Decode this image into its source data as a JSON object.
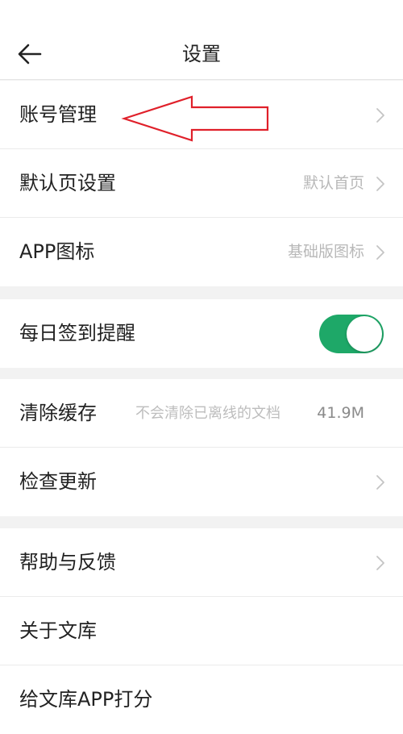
{
  "header": {
    "title": "设置",
    "back_icon": "arrow-left-icon"
  },
  "groups": [
    {
      "rows": [
        {
          "label": "账号管理",
          "value": "",
          "chevron": true
        },
        {
          "label": "默认页设置",
          "value": "默认首页",
          "chevron": true
        },
        {
          "label": "APP图标",
          "value": "基础版图标",
          "chevron": true
        }
      ]
    },
    {
      "rows": [
        {
          "label": "每日签到提醒",
          "toggle_on": true
        }
      ]
    },
    {
      "rows": [
        {
          "label": "清除缓存",
          "hint": "不会清除已离线的文档",
          "value": "41.9M"
        },
        {
          "label": "检查更新",
          "chevron": true
        }
      ]
    },
    {
      "rows": [
        {
          "label": "帮助与反馈",
          "chevron": true
        },
        {
          "label": "关于文库"
        },
        {
          "label": "给文库APP打分"
        }
      ]
    }
  ],
  "colors": {
    "toggle_on": "#1ea868",
    "annotation_arrow": "#e0202a",
    "background": "#f2f2f2"
  }
}
